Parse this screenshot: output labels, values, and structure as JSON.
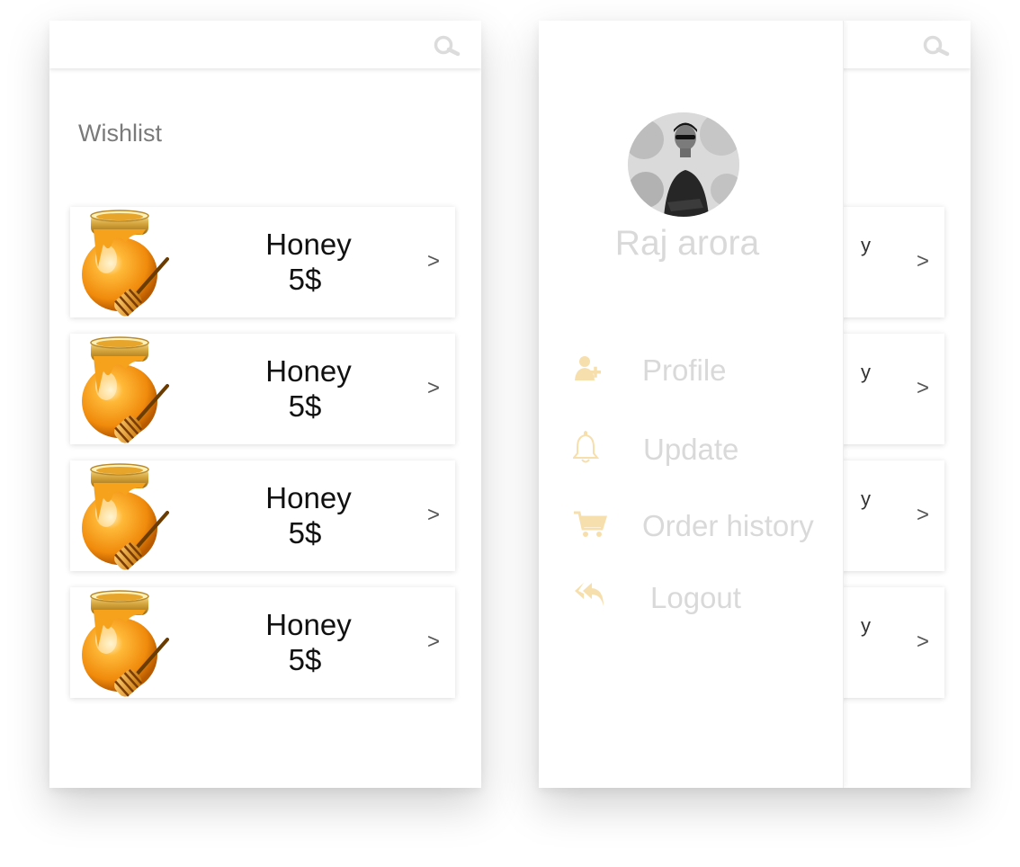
{
  "colors": {
    "accent": "#f7dfad",
    "drawer_text": "#d9d9d9",
    "title": "#7a7a7a",
    "price_text": "#111111"
  },
  "screen_left": {
    "topbar": {
      "icon": "search-icon"
    },
    "title": "Wishlist",
    "items": [
      {
        "name": "Honey",
        "price": "5$",
        "chevron": ">",
        "icon": "honey-pot-icon"
      },
      {
        "name": "Honey",
        "price": "5$",
        "chevron": ">",
        "icon": "honey-pot-icon"
      },
      {
        "name": "Honey",
        "price": "5$",
        "chevron": ">",
        "icon": "honey-pot-icon"
      },
      {
        "name": "Honey",
        "price": "5$",
        "chevron": ">",
        "icon": "honey-pot-icon"
      }
    ]
  },
  "screen_right": {
    "topbar": {
      "icon": "search-icon"
    },
    "drawer": {
      "user_name": "Raj arora",
      "avatar": "avatar-photo",
      "menu": [
        {
          "label": "Profile",
          "icon": "add-user-icon"
        },
        {
          "label": "Update",
          "icon": "bell-icon"
        },
        {
          "label": "Order history",
          "icon": "cart-icon"
        },
        {
          "label": "Logout",
          "icon": "reply-all-icon"
        }
      ]
    },
    "items": [
      {
        "peek": "y",
        "chevron": ">"
      },
      {
        "peek": "y",
        "chevron": ">"
      },
      {
        "peek": "y",
        "chevron": ">"
      },
      {
        "peek": "y",
        "chevron": ">"
      }
    ]
  }
}
